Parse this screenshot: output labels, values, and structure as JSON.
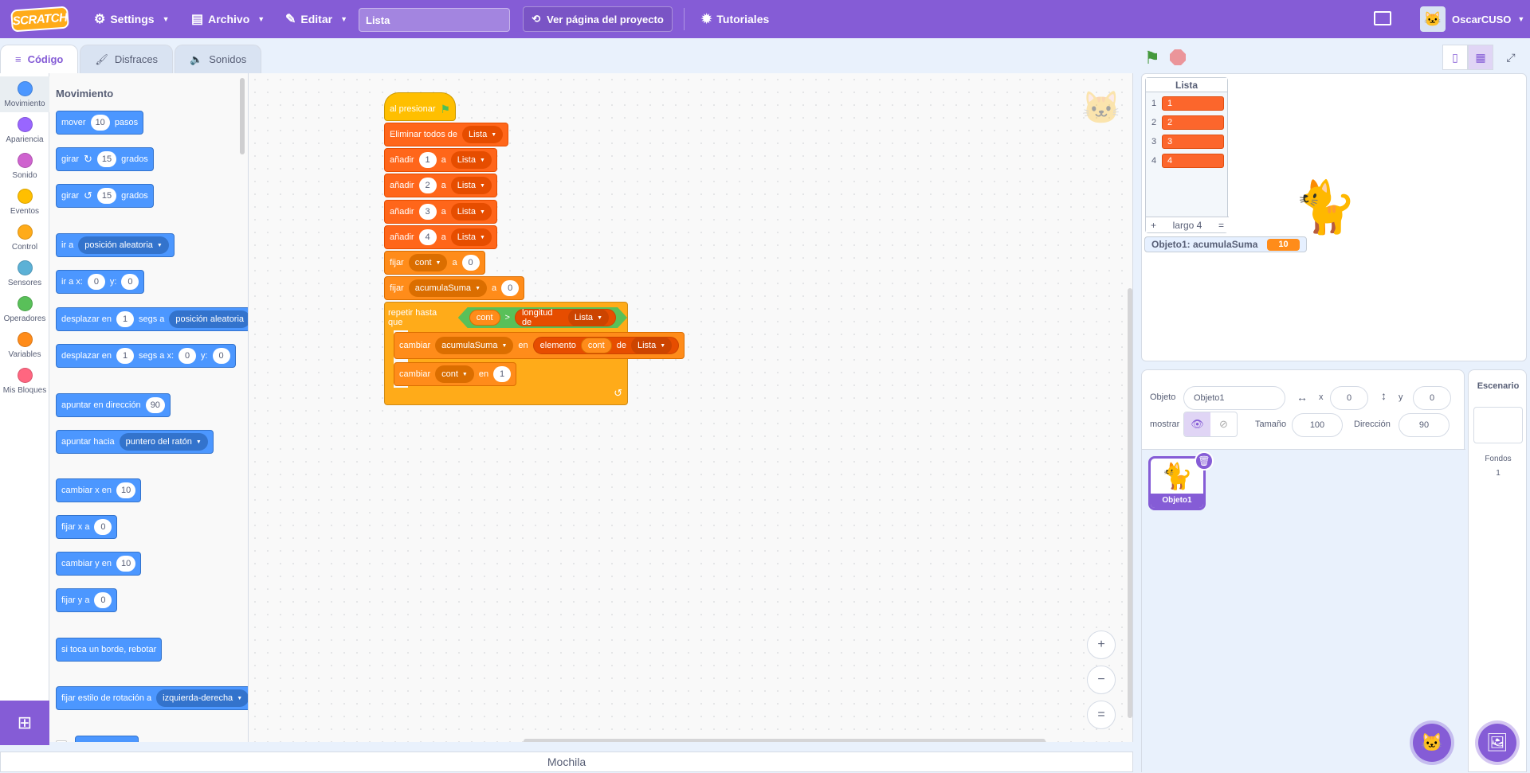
{
  "menubar": {
    "logo": "SCRATCH",
    "settings": "Settings",
    "file": "Archivo",
    "edit": "Editar",
    "project_title": "Lista",
    "see_project": "Ver página del proyecto",
    "tutorials": "Tutoriales",
    "username": "OscarCUSO"
  },
  "tabs": [
    "Código",
    "Disfraces",
    "Sonidos"
  ],
  "categories": [
    {
      "label": "Movimiento",
      "color": "#4c97ff"
    },
    {
      "label": "Apariencia",
      "color": "#9966ff"
    },
    {
      "label": "Sonido",
      "color": "#cf63cf"
    },
    {
      "label": "Eventos",
      "color": "#ffbf00"
    },
    {
      "label": "Control",
      "color": "#ffab19"
    },
    {
      "label": "Sensores",
      "color": "#5cb1d6"
    },
    {
      "label": "Operadores",
      "color": "#59c059"
    },
    {
      "label": "Variables",
      "color": "#ff8c1a"
    },
    {
      "label": "Mis Bloques",
      "color": "#ff6680"
    }
  ],
  "palette": {
    "title": "Movimiento",
    "move": {
      "t1": "mover",
      "v": "10",
      "t2": "pasos"
    },
    "turn_right": {
      "t1": "girar",
      "v": "15",
      "t2": "grados"
    },
    "turn_left": {
      "t1": "girar",
      "v": "15",
      "t2": "grados"
    },
    "goto": {
      "t1": "ir a",
      "d": "posición aleatoria"
    },
    "goto_xy": {
      "t1": "ir a x:",
      "x": "0",
      "t2": "y:",
      "y": "0"
    },
    "glide": {
      "t1": "desplazar en",
      "v": "1",
      "t2": "segs a",
      "d": "posición aleatoria"
    },
    "glide_xy": {
      "t1": "desplazar en",
      "v": "1",
      "t2": "segs a x:",
      "x": "0",
      "t3": "y:",
      "y": "0"
    },
    "point_dir": {
      "t1": "apuntar en dirección",
      "v": "90"
    },
    "point_towards": {
      "t1": "apuntar hacia",
      "d": "puntero del ratón"
    },
    "change_x": {
      "t1": "cambiar x en",
      "v": "10"
    },
    "set_x": {
      "t1": "fijar x a",
      "v": "0"
    },
    "change_y": {
      "t1": "cambiar y en",
      "v": "10"
    },
    "set_y": {
      "t1": "fijar y a",
      "v": "0"
    },
    "bounce": {
      "t1": "si toca un borde, rebotar"
    },
    "rotation": {
      "t1": "fijar estilo de rotación a",
      "d": "izquierda-derecha"
    }
  },
  "script": {
    "hat": "al presionar",
    "delete_all": {
      "t": "Eliminar todos de",
      "d": "Lista"
    },
    "adds": [
      {
        "t1": "añadir",
        "v": "1",
        "t2": "a",
        "d": "Lista"
      },
      {
        "t1": "añadir",
        "v": "2",
        "t2": "a",
        "d": "Lista"
      },
      {
        "t1": "añadir",
        "v": "3",
        "t2": "a",
        "d": "Lista"
      },
      {
        "t1": "añadir",
        "v": "4",
        "t2": "a",
        "d": "Lista"
      }
    ],
    "set_cont": {
      "t1": "fijar",
      "d": "cont",
      "t2": "a",
      "v": "0"
    },
    "set_sum": {
      "t1": "fijar",
      "d": "acumulaSuma",
      "t2": "a",
      "v": "0"
    },
    "repeat": {
      "t": "repetir hasta que",
      "a": "cont",
      "op": ">",
      "len": "longitud de",
      "d": "Lista"
    },
    "change_sum": {
      "t1": "cambiar",
      "d": "acumulaSuma",
      "t2": "en",
      "item": "elemento",
      "var": "cont",
      "t3": "de",
      "list": "Lista"
    },
    "change_cont": {
      "t1": "cambiar",
      "d": "cont",
      "t2": "en",
      "v": "1"
    }
  },
  "zoom": {
    "in": "+",
    "out": "−",
    "reset": "="
  },
  "stage": {
    "list_monitor": {
      "title": "Lista",
      "items": [
        "1",
        "2",
        "3",
        "4"
      ],
      "add": "+",
      "length": "largo 4",
      "resize": "="
    },
    "var_monitor": {
      "label": "Objeto1: acumulaSuma",
      "value": "10"
    }
  },
  "sprite_info": {
    "sprite_label": "Objeto",
    "sprite_name": "Objeto1",
    "x_label": "x",
    "x": "0",
    "y_label": "y",
    "y": "0",
    "show_label": "mostrar",
    "size_label": "Tamaño",
    "size": "100",
    "dir_label": "Dirección",
    "dir": "90"
  },
  "sprites": [
    {
      "name": "Objeto1"
    }
  ],
  "stage_pane": {
    "title": "Escenario",
    "backdrops_label": "Fondos",
    "backdrops_count": "1"
  },
  "backpack": "Mochila",
  "colors": {
    "brand": "#855cd6",
    "motion": "#4c97ff",
    "events": "#ffbf00",
    "control": "#ffab19",
    "variables": "#ff8c1a",
    "lists": "#ff661a",
    "operators": "#59c059"
  }
}
